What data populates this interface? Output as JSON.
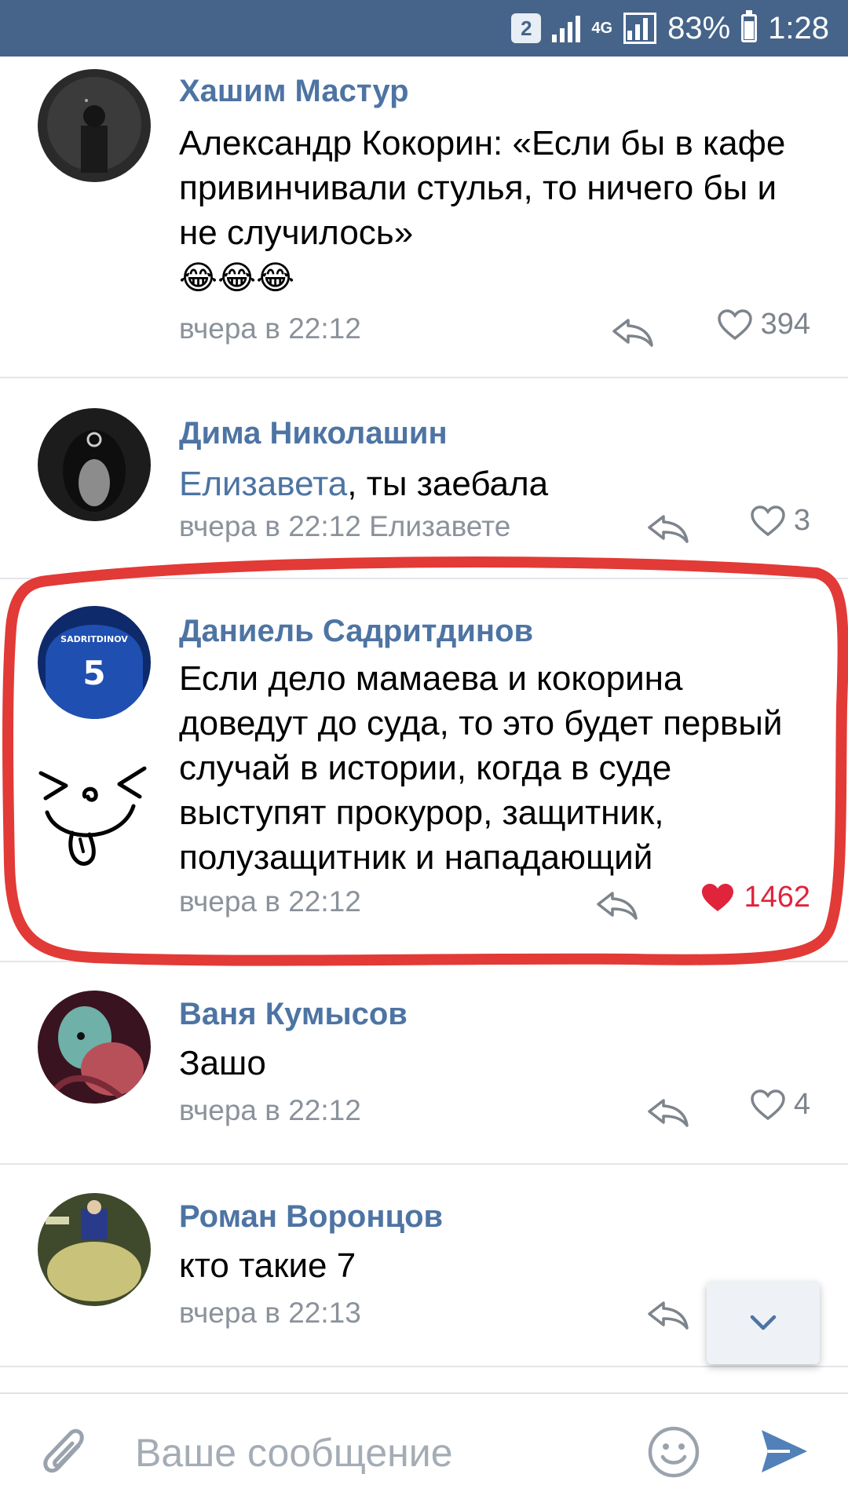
{
  "status_bar": {
    "sim": "2",
    "network": "4G",
    "battery": "83%",
    "time": "1:28"
  },
  "comments": [
    {
      "author": "Хашим Мастур",
      "text": "Александр Кокорин: «Если бы в кафе привинчивали стулья, то ничего бы и не случилось»",
      "emoji": "😂😂😂",
      "meta": "вчера в 22:12",
      "likes": "394",
      "liked": false
    },
    {
      "author": "Дима Николашин",
      "mention": "Елизавета",
      "text": ", ты заебала",
      "meta": "вчера в 22:12 Елизавете",
      "likes": "3",
      "liked": false
    },
    {
      "author": "Даниель Садритдинов",
      "text": "Если дело мамаева и кокорина доведут до суда, то это будет первый случай в истории, когда в суде выступят прокурор, защитник, полузащитник и нападающий",
      "meta": "вчера в 22:12",
      "likes": "1462",
      "liked": true,
      "jersey_name": "SADRITDINOV",
      "jersey_number": "5"
    },
    {
      "author": "Ваня Кумысов",
      "text": "Зашо",
      "meta": "вчера в 22:12",
      "likes": "4",
      "liked": false
    },
    {
      "author": "Роман Воронцов",
      "text": "кто такие 7",
      "meta": "вчера в 22:13",
      "likes": "",
      "liked": false
    }
  ],
  "composer": {
    "placeholder": "Ваше сообщение"
  },
  "icons": {
    "attach": "paperclip-icon",
    "emoji": "smile-icon",
    "send": "send-icon",
    "reply": "reply-icon",
    "like": "heart-icon",
    "scroll": "chevron-down-icon"
  },
  "colors": {
    "header": "#46648a",
    "link": "#4d74a3",
    "liked": "#e0243c",
    "annotation": "#e23a36"
  }
}
